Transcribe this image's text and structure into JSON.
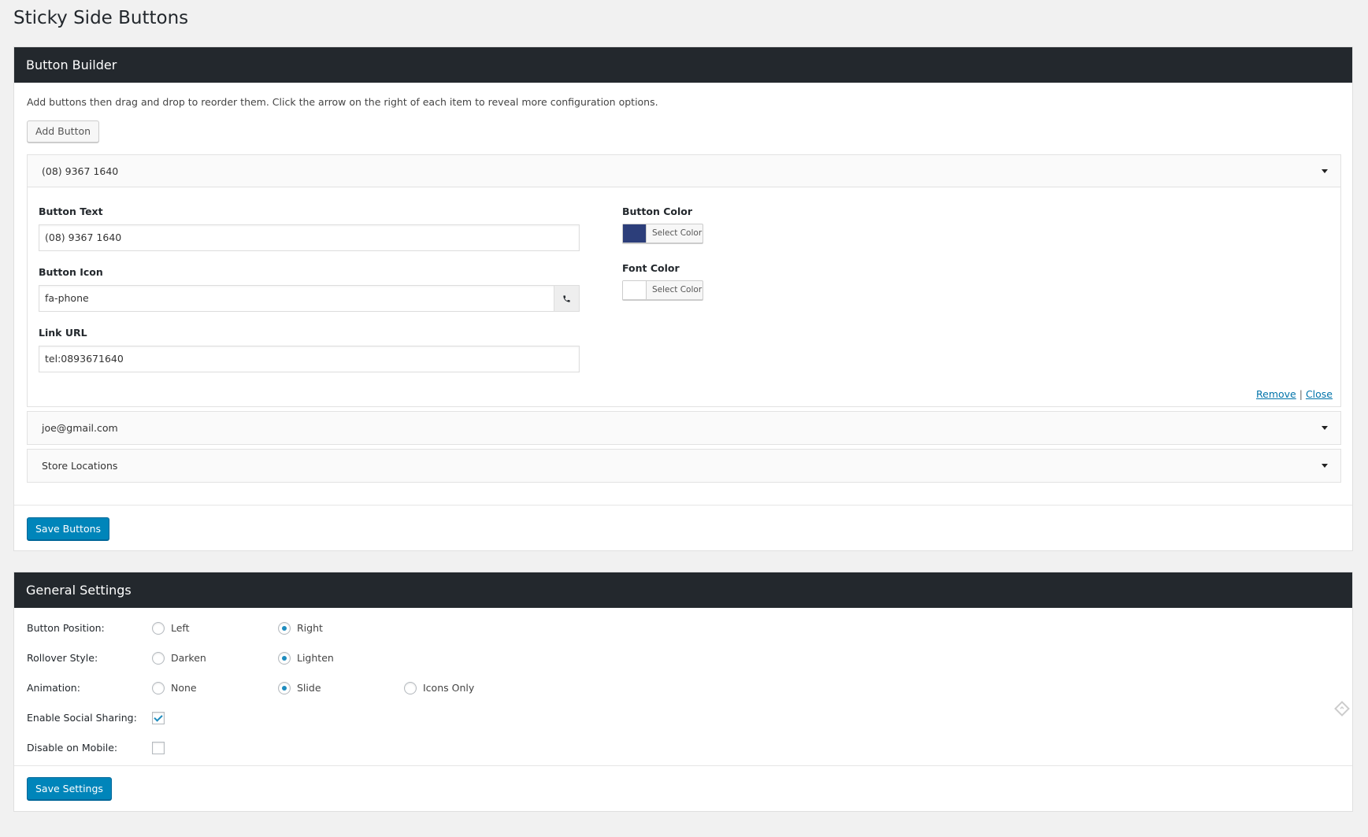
{
  "page_title": "Sticky Side Buttons",
  "builder": {
    "header": "Button Builder",
    "intro": "Add buttons then drag and drop to reorder them. Click the arrow on the right of each item to reveal more configuration options.",
    "add_button_label": "Add Button",
    "items": [
      {
        "title": "(08) 9367 1640",
        "expanded": true,
        "button_text_label": "Button Text",
        "button_text_value": "(08) 9367 1640",
        "button_icon_label": "Button Icon",
        "button_icon_value": "fa-phone",
        "button_icon_symbol": "phone-icon",
        "link_url_label": "Link URL",
        "link_url_value": "tel:0893671640",
        "button_color_label": "Button Color",
        "button_color_value": "#2c3e7a",
        "font_color_label": "Font Color",
        "font_color_value": "#ffffff",
        "select_color_label": "Select Color",
        "remove_label": "Remove",
        "separator": "|",
        "close_label": "Close"
      },
      {
        "title": "joe@gmail.com",
        "expanded": false
      },
      {
        "title": "Store Locations",
        "expanded": false
      }
    ],
    "save_label": "Save Buttons"
  },
  "settings": {
    "header": "General Settings",
    "button_position": {
      "label": "Button Position:",
      "options": [
        "Left",
        "Right"
      ],
      "selected": "Right"
    },
    "rollover_style": {
      "label": "Rollover Style:",
      "options": [
        "Darken",
        "Lighten"
      ],
      "selected": "Lighten"
    },
    "animation": {
      "label": "Animation:",
      "options": [
        "None",
        "Slide",
        "Icons Only"
      ],
      "selected": "Slide"
    },
    "social_sharing": {
      "label": "Enable Social Sharing:",
      "checked": true
    },
    "disable_mobile": {
      "label": "Disable on Mobile:",
      "checked": false
    },
    "save_label": "Save Settings"
  },
  "colors": {
    "header_bg": "#23282d",
    "primary_button": "#0085ba",
    "accent": "#1e8cbe"
  }
}
